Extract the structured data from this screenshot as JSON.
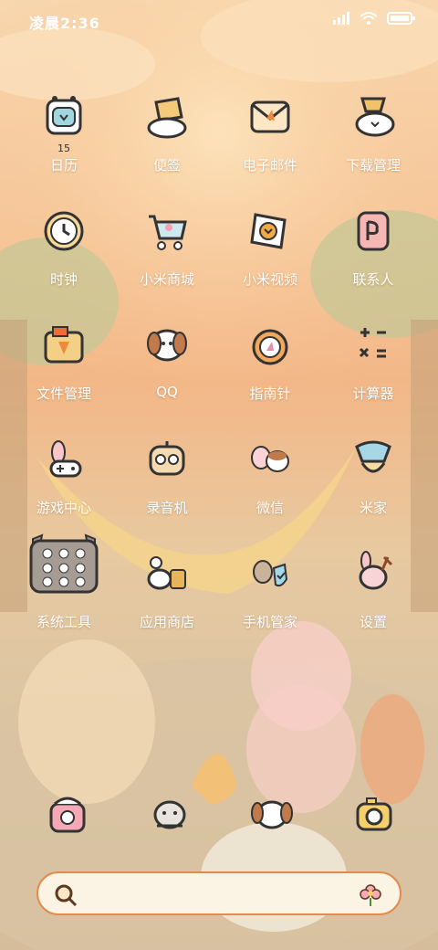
{
  "status_bar": {
    "time": "凌晨2:36"
  },
  "apps": [
    {
      "label": "日历",
      "sub": "15",
      "icon": "calendar-icon"
    },
    {
      "label": "便签",
      "icon": "notes-icon"
    },
    {
      "label": "电子邮件",
      "icon": "email-icon"
    },
    {
      "label": "下载管理",
      "icon": "download-icon"
    },
    {
      "label": "时钟",
      "icon": "clock-icon"
    },
    {
      "label": "小米商城",
      "icon": "shopping-cart-icon"
    },
    {
      "label": "小米视频",
      "icon": "video-icon"
    },
    {
      "label": "联系人",
      "icon": "contacts-icon"
    },
    {
      "label": "文件管理",
      "icon": "folder-icon"
    },
    {
      "label": "QQ",
      "icon": "qq-icon"
    },
    {
      "label": "指南针",
      "icon": "compass-icon"
    },
    {
      "label": "计算器",
      "icon": "calculator-icon"
    },
    {
      "label": "游戏中心",
      "icon": "game-center-icon"
    },
    {
      "label": "录音机",
      "icon": "recorder-icon"
    },
    {
      "label": "微信",
      "icon": "wechat-icon"
    },
    {
      "label": "米家",
      "icon": "mijia-icon"
    },
    {
      "label": "系统工具",
      "icon": "system-tools-folder-icon"
    },
    {
      "label": "应用商店",
      "icon": "app-store-icon"
    },
    {
      "label": "手机管家",
      "icon": "security-icon"
    },
    {
      "label": "设置",
      "icon": "settings-icon"
    }
  ],
  "dock": [
    "phone-icon",
    "contacts-cat-icon",
    "messages-icon",
    "camera-icon"
  ],
  "colors": {
    "accent": "#e38b4c",
    "label": "#ffffff",
    "search_bg": "#fbf3e4"
  }
}
